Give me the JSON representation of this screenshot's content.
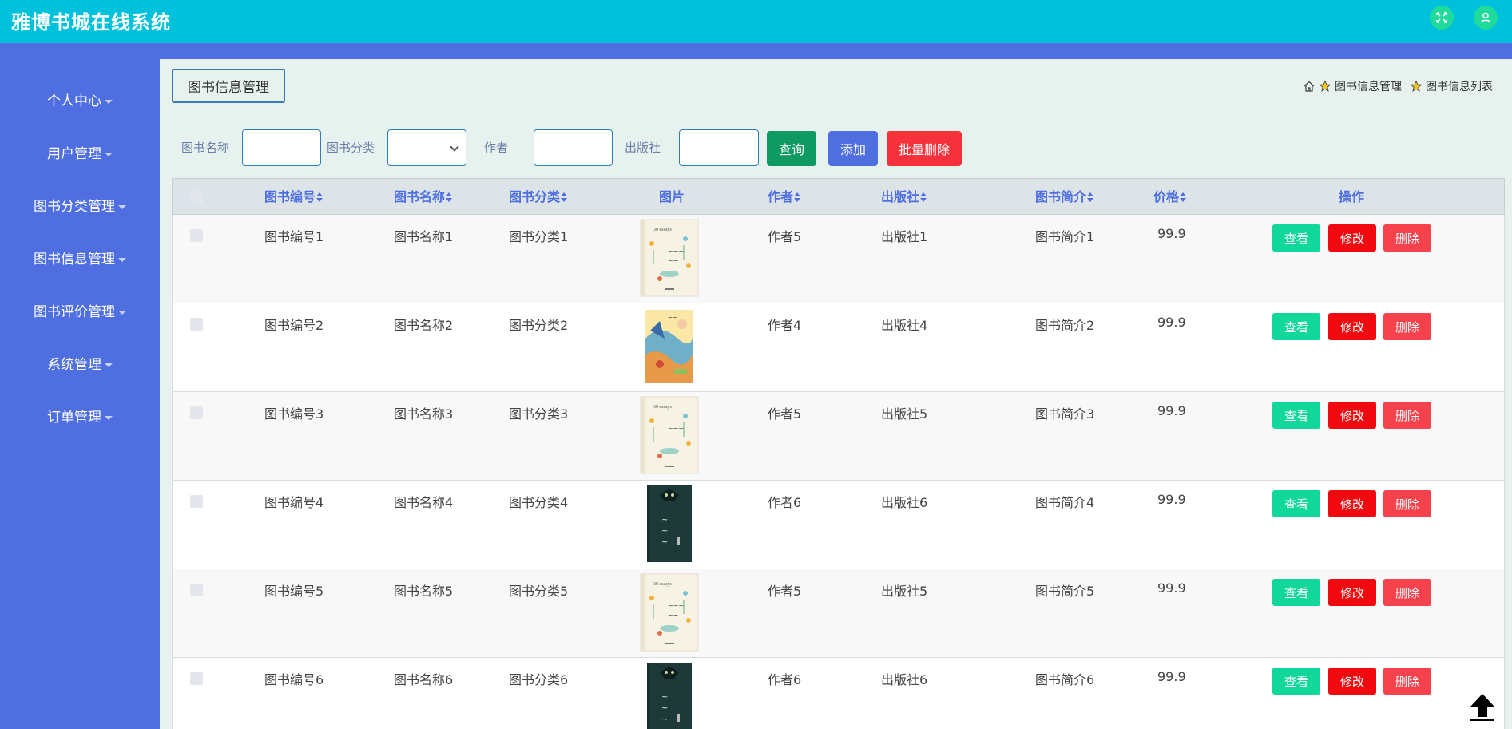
{
  "app": {
    "title": "雅博书城在线系统"
  },
  "topbar": {
    "icons": [
      "expand-icon",
      "user-icon"
    ]
  },
  "sidebar": {
    "items": [
      {
        "label": "个人中心"
      },
      {
        "label": "用户管理"
      },
      {
        "label": "图书分类管理"
      },
      {
        "label": "图书信息管理"
      },
      {
        "label": "图书评价管理"
      },
      {
        "label": "系统管理"
      },
      {
        "label": "订单管理"
      }
    ]
  },
  "page": {
    "tab": "图书信息管理"
  },
  "breadcrumb": {
    "items": [
      "图书信息管理",
      "图书信息列表"
    ]
  },
  "search": {
    "name_label": "图书名称",
    "name_value": "",
    "category_label": "图书分类",
    "category_value": "",
    "author_label": "作者",
    "author_value": "",
    "publisher_label": "出版社",
    "publisher_value": "",
    "query_button": "查询",
    "add_button": "添加",
    "batch_delete_button": "批量删除"
  },
  "table": {
    "headers": {
      "book_no": "图书编号",
      "book_name": "图书名称",
      "category": "图书分类",
      "image": "图片",
      "author": "作者",
      "publisher": "出版社",
      "intro": "图书简介",
      "price": "价格",
      "actions": "操作"
    },
    "action_labels": {
      "view": "查看",
      "edit": "修改",
      "delete": "删除"
    },
    "rows": [
      {
        "book_no": "图书编号1",
        "book_name": "图书名称1",
        "category": "图书分类1",
        "cover": "essays",
        "author": "作者5",
        "publisher": "出版社1",
        "intro": "图书简介1",
        "price": "99.9"
      },
      {
        "book_no": "图书编号2",
        "book_name": "图书名称2",
        "category": "图书分类2",
        "cover": "colorful",
        "author": "作者4",
        "publisher": "出版社4",
        "intro": "图书简介2",
        "price": "99.9"
      },
      {
        "book_no": "图书编号3",
        "book_name": "图书名称3",
        "category": "图书分类3",
        "cover": "essays",
        "author": "作者5",
        "publisher": "出版社5",
        "intro": "图书简介3",
        "price": "99.9"
      },
      {
        "book_no": "图书编号4",
        "book_name": "图书名称4",
        "category": "图书分类4",
        "cover": "wolf",
        "author": "作者6",
        "publisher": "出版社6",
        "intro": "图书简介4",
        "price": "99.9"
      },
      {
        "book_no": "图书编号5",
        "book_name": "图书名称5",
        "category": "图书分类5",
        "cover": "essays",
        "author": "作者5",
        "publisher": "出版社5",
        "intro": "图书简介5",
        "price": "99.9"
      },
      {
        "book_no": "图书编号6",
        "book_name": "图书名称6",
        "category": "图书分类6",
        "cover": "wolf",
        "author": "作者6",
        "publisher": "出版社6",
        "intro": "图书简介6",
        "price": "99.9"
      }
    ]
  },
  "colors": {
    "topbar": "#00c1dc",
    "sidebar": "#4f6fe1",
    "content_bg": "#e7f2ee",
    "view": "#12d79a",
    "edit": "#f00a0f",
    "delete": "#f6424d"
  },
  "back_to_top_icon": "arrow-up-icon"
}
